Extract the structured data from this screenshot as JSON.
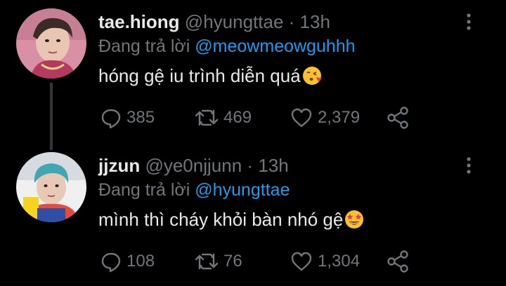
{
  "colors": {
    "background": "#000000",
    "primary_text": "#e7e9ea",
    "secondary_text": "#71767b",
    "accent": "#1d9bf0"
  },
  "tweets": [
    {
      "display_name": "tae.hiong",
      "handle": "@hyungttae",
      "separator": "·",
      "time": "13h",
      "reply_prefix": "Đang trả lời",
      "reply_to": "@meowmeowguhhh",
      "text": "hóng gệ iu trình diễn quá",
      "emoji": "face-blowing-a-kiss-icon",
      "stats": {
        "replies": "385",
        "retweets": "469",
        "likes": "2,379"
      }
    },
    {
      "display_name": "jjzun",
      "handle": "@ye0njjunn",
      "separator": "·",
      "time": "13h",
      "reply_prefix": "Đang trả lời",
      "reply_to": "@hyungttae",
      "text": "mình thì cháy khỏi bàn nhó gệ",
      "emoji": "star-struck-icon",
      "stats": {
        "replies": "108",
        "retweets": "76",
        "likes": "1,304"
      }
    }
  ]
}
